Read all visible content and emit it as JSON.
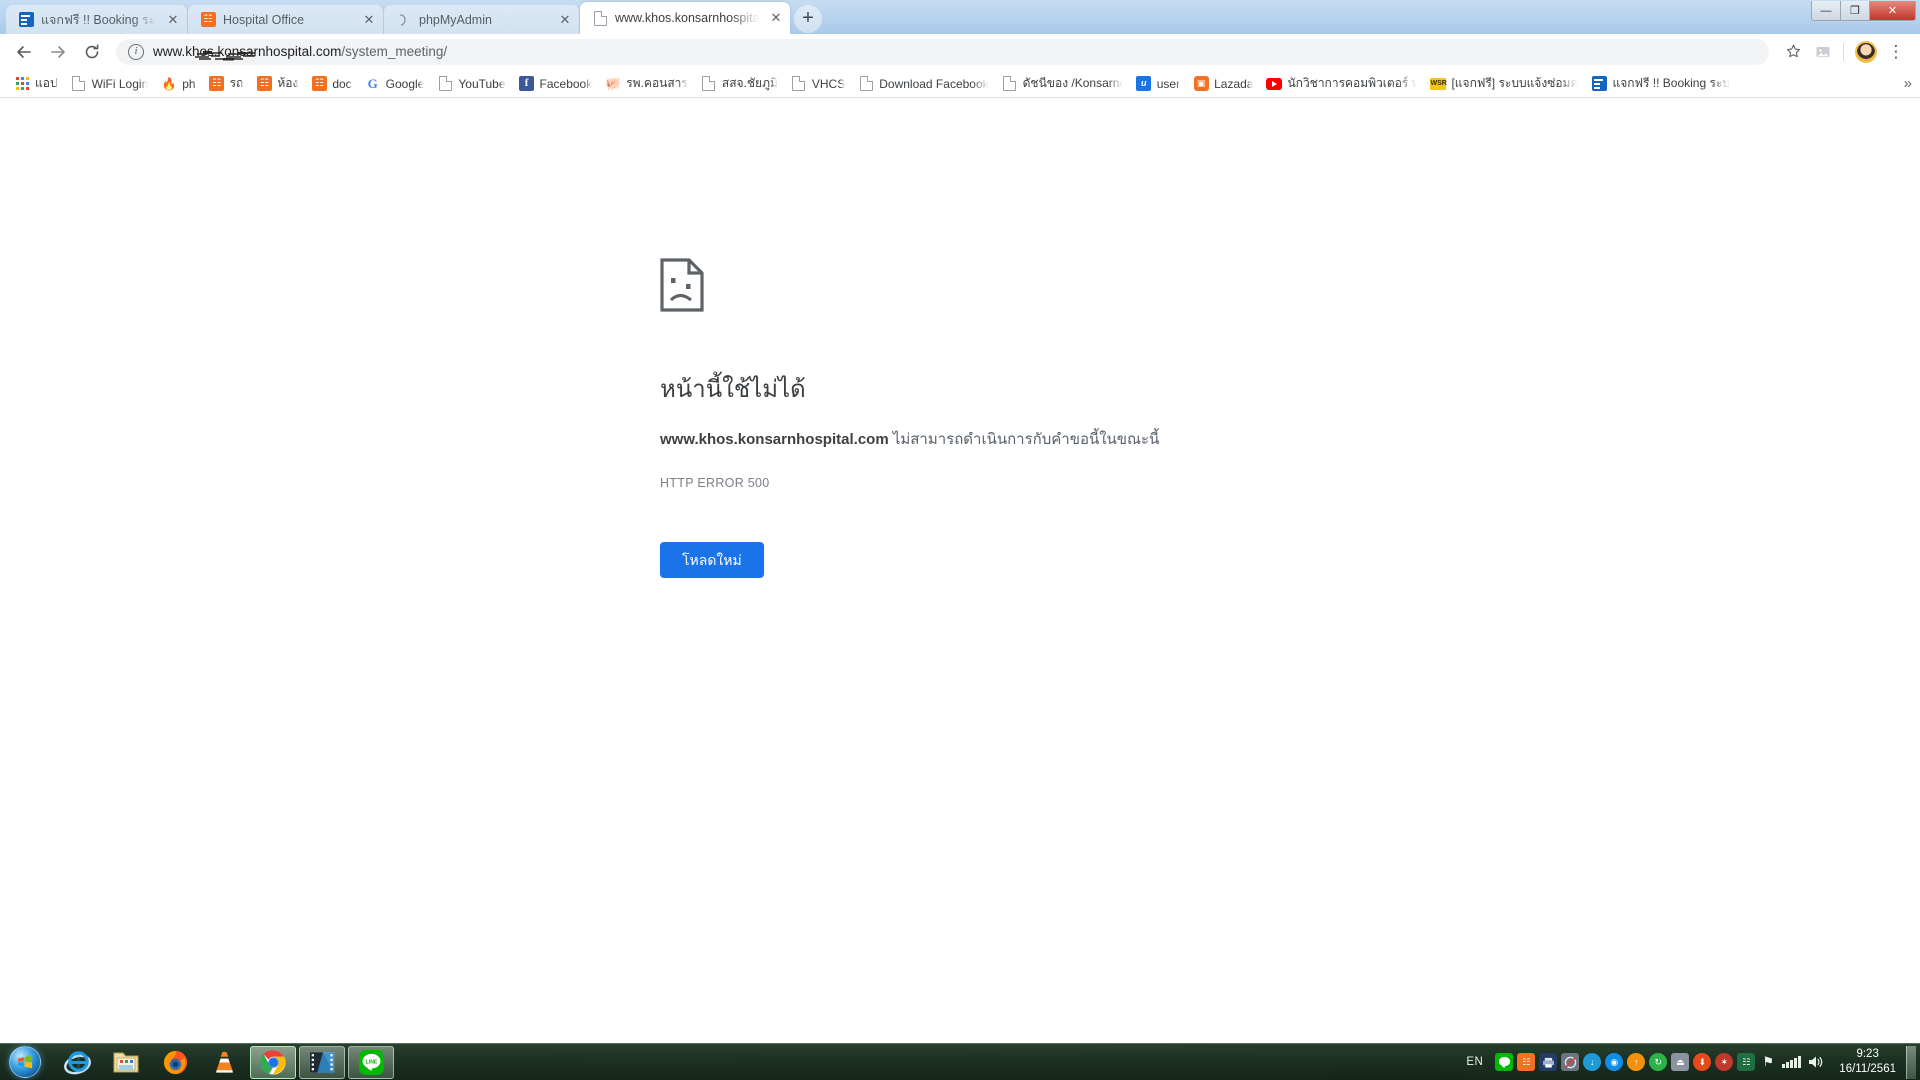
{
  "window": {
    "controls": [
      {
        "name": "minimize",
        "glyph": "—"
      },
      {
        "name": "restore",
        "glyph": "❐"
      },
      {
        "name": "close",
        "glyph": "✕"
      }
    ]
  },
  "tabs": [
    {
      "title": "แจกฟรี !! Booking ระบบจองห้องประ",
      "favicon": "blue-form-icon",
      "active": false,
      "close_glyph": "✕"
    },
    {
      "title": "Hospital Office",
      "favicon": "xampp-icon",
      "active": false,
      "close_glyph": "✕"
    },
    {
      "title": "phpMyAdmin",
      "favicon": "phpmyadmin-icon",
      "active": false,
      "close_glyph": "✕"
    },
    {
      "title": "www.khos.konsarnhospital.com",
      "favicon": "generic-page-icon",
      "active": true,
      "close_glyph": "✕"
    }
  ],
  "newtab_glyph": "+",
  "toolbar": {
    "back_glyph": "←",
    "forward_glyph": "→",
    "reload_glyph": "⟳",
    "info_glyph": "i",
    "url_host": "www.khos.konsarnhospital.com",
    "url_path": "/system_meeting/",
    "url_full": "www.khos.konsarnhospital.com/system_meeting/",
    "star_glyph": "☆",
    "extension_glyph": "❑",
    "menu_glyph": "⋮"
  },
  "bookmarks": {
    "overflow_glyph": "»",
    "items": [
      {
        "label": "แอป",
        "icon": "apps-grid-icon"
      },
      {
        "label": "WiFi Login",
        "icon": "doc-icon"
      },
      {
        "label": "ph",
        "icon": "firefox-icon"
      },
      {
        "label": "รถ",
        "icon": "xampp-icon"
      },
      {
        "label": "ห้อง",
        "icon": "xampp-icon"
      },
      {
        "label": "doc",
        "icon": "xampp-icon"
      },
      {
        "label": "Google",
        "icon": "google-icon"
      },
      {
        "label": "YouTube",
        "icon": "doc-icon"
      },
      {
        "label": "Facebook",
        "icon": "facebook-icon"
      },
      {
        "label": "รพ.คอนสาร",
        "icon": "pig-icon"
      },
      {
        "label": "สสจ.ชัยภูมิ",
        "icon": "doc-icon"
      },
      {
        "label": "VHCS",
        "icon": "doc-icon"
      },
      {
        "label": "Download Facebook",
        "icon": "doc-icon"
      },
      {
        "label": "ดัชนีของ /Konsarn/",
        "icon": "doc-icon"
      },
      {
        "label": "user",
        "icon": "user-blue-icon"
      },
      {
        "label": "Lazada",
        "icon": "lazada-icon"
      },
      {
        "label": "นักวิชาการคอมพิวเตอร์ ท",
        "icon": "youtube-icon"
      },
      {
        "label": "[แจกฟรี] ระบบแจ้งซ่อมค",
        "icon": "yellow-badge-icon"
      },
      {
        "label": "แจกฟรี !! Booking ระบ",
        "icon": "blue-form-icon"
      }
    ]
  },
  "error_page": {
    "icon": "sad-page-icon",
    "title": "หน้านี้ใช้ไม่ได้",
    "desc_host": "www.khos.konsarnhospital.com",
    "desc_rest": " ไม่สามารถดำเนินการกับคำขอนี้ในขณะนี้",
    "code": "HTTP ERROR 500",
    "reload_label": "โหลดใหม่",
    "button_color": "#1a73e8"
  },
  "taskbar": {
    "start_label": "start-orb",
    "apps": [
      {
        "name": "internet-explorer",
        "glyph": "e",
        "state": "pinned"
      },
      {
        "name": "windows-explorer",
        "glyph": "folder",
        "state": "pinned"
      },
      {
        "name": "mozilla-firefox",
        "glyph": "firefox",
        "state": "pinned"
      },
      {
        "name": "vlc-media-player",
        "glyph": "cone",
        "state": "pinned"
      },
      {
        "name": "google-chrome",
        "glyph": "chrome",
        "state": "active"
      },
      {
        "name": "video-editor",
        "glyph": "film",
        "state": "running"
      },
      {
        "name": "line-messenger",
        "glyph": "LINE",
        "state": "running"
      }
    ],
    "tray": {
      "language": "EN",
      "icons": [
        {
          "name": "line-tray-icon",
          "color": "#00b900",
          "glyph": "●"
        },
        {
          "name": "xampp-tray-icon",
          "color": "#f36f21",
          "glyph": "⧉"
        },
        {
          "name": "printer-tray-icon",
          "color": "#2b4e7e",
          "glyph": "⎙"
        },
        {
          "name": "network-monitor-icon",
          "color": "#5c6670",
          "glyph": "◎"
        },
        {
          "name": "idm-tray-icon",
          "color": "#1e9ad6",
          "glyph": "↓"
        },
        {
          "name": "teamviewer-icon",
          "color": "#0e8ee9",
          "glyph": "◉"
        },
        {
          "name": "update-tray-icon",
          "color": "#f2920c",
          "glyph": "↑"
        },
        {
          "name": "sync-tray-icon",
          "color": "#2db34a",
          "glyph": "↻"
        },
        {
          "name": "usb-safely-remove-icon",
          "color": "#7b8794",
          "glyph": "⏏"
        },
        {
          "name": "download-manager-icon",
          "color": "#e64a19",
          "glyph": "⬇"
        },
        {
          "name": "ccleaner-icon",
          "color": "#c0392b",
          "glyph": "✦"
        },
        {
          "name": "excel-tray-icon",
          "color": "#1f6f43",
          "glyph": "☷"
        },
        {
          "name": "action-center-icon",
          "color": "#e8e8e8",
          "glyph": "⚑"
        }
      ],
      "network_icon": "signal-bars-icon",
      "volume_icon": "speaker-icon",
      "time": "9:23",
      "date": "16/11/2561"
    }
  }
}
